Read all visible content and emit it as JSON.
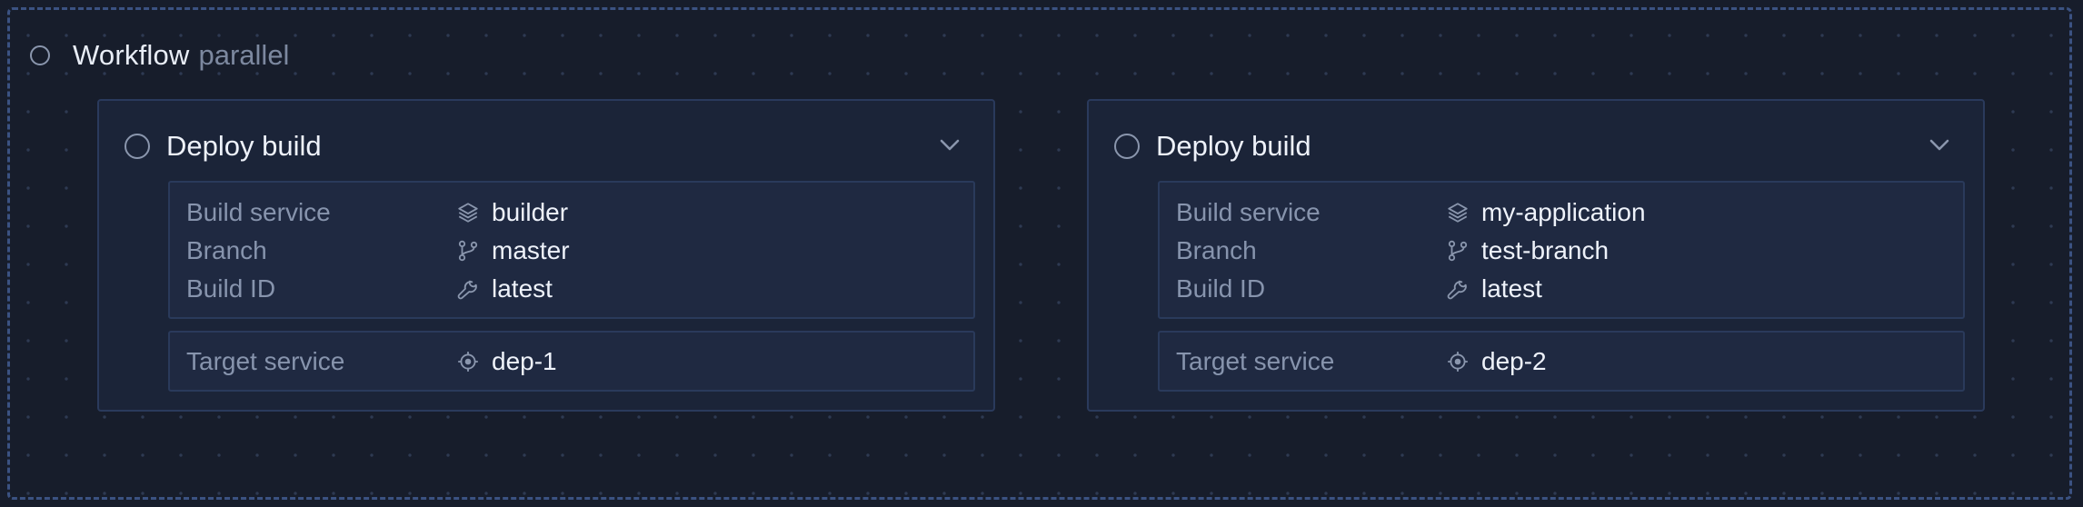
{
  "workflow": {
    "title": "Workflow",
    "mode": "parallel"
  },
  "steps": [
    {
      "title": "Deploy build",
      "details": [
        {
          "label": "Build service",
          "icon": "layers-icon",
          "value": "builder"
        },
        {
          "label": "Branch",
          "icon": "git-branch-icon",
          "value": "master"
        },
        {
          "label": "Build ID",
          "icon": "wrench-icon",
          "value": "latest"
        }
      ],
      "target": {
        "label": "Target service",
        "icon": "crosshair-icon",
        "value": "dep-1"
      }
    },
    {
      "title": "Deploy build",
      "details": [
        {
          "label": "Build service",
          "icon": "layers-icon",
          "value": "my-application"
        },
        {
          "label": "Branch",
          "icon": "git-branch-icon",
          "value": "test-branch"
        },
        {
          "label": "Build ID",
          "icon": "wrench-icon",
          "value": "latest"
        }
      ],
      "target": {
        "label": "Target service",
        "icon": "crosshair-icon",
        "value": "dep-2"
      }
    }
  ],
  "colors": {
    "background": "#171d2b",
    "card": "#1b2438",
    "panel": "#1f2941",
    "dashed_border": "#3b5282",
    "label_text": "#8794ad",
    "value_text": "#eef2fa"
  }
}
